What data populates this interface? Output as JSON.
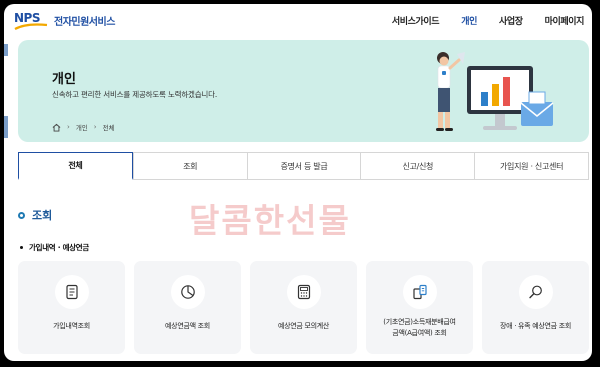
{
  "header": {
    "logo_mark": "NPS",
    "logo_text": "전자민원서비스",
    "nav": [
      {
        "label": "서비스가이드",
        "active": false
      },
      {
        "label": "개인",
        "active": true
      },
      {
        "label": "사업장",
        "active": false
      },
      {
        "label": "마이페이지",
        "active": false
      }
    ]
  },
  "banner": {
    "title": "개인",
    "subtitle": "신속하고 편리한 서비스를 제공하도록 노력하겠습니다.",
    "breadcrumb": [
      "개인",
      "전체"
    ]
  },
  "tabs": [
    {
      "label": "전체",
      "active": true
    },
    {
      "label": "조회",
      "active": false
    },
    {
      "label": "증명서 등 발급",
      "active": false
    },
    {
      "label": "신고/신청",
      "active": false
    },
    {
      "label": "가입지원 · 신고센터",
      "active": false
    }
  ],
  "section": {
    "title": "조회",
    "subsection": "가입내역 · 예상연금"
  },
  "watermark": "달콤한선물",
  "cards": [
    {
      "icon": "document-icon",
      "label": "가입내역조회"
    },
    {
      "icon": "pie-chart-icon",
      "label": "예상연금액 조회"
    },
    {
      "icon": "calculator-icon",
      "label": "예상연금 모의계산"
    },
    {
      "icon": "documents-icon",
      "label_line1": "(기초연금)소득재분배급여",
      "label_line2": "금액(A급여액) 조회"
    },
    {
      "icon": "magnifier-icon",
      "label": "장애 · 유족 예상연금 조회"
    }
  ],
  "colors": {
    "brand": "#1f4fa3",
    "banner_bg": "#cfeee8",
    "card_bg": "#f4f5f7",
    "section_title": "#1f5a99"
  }
}
